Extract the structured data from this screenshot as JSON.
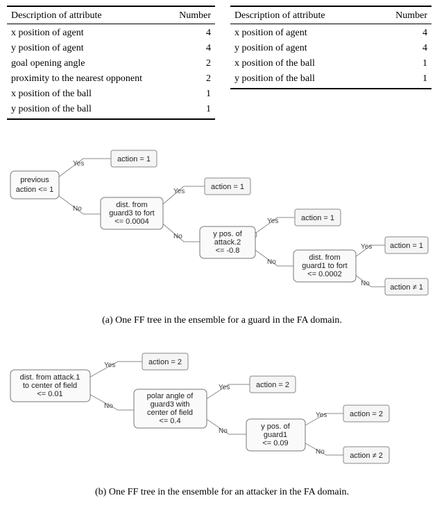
{
  "tables": {
    "left": {
      "headers": {
        "desc": "Description of attribute",
        "num": "Number"
      },
      "rows": [
        {
          "desc": "x position of agent",
          "num": "4"
        },
        {
          "desc": "y position of agent",
          "num": "4"
        },
        {
          "desc": "goal opening angle",
          "num": "2"
        },
        {
          "desc": "proximity to the nearest opponent",
          "num": "2"
        },
        {
          "desc": "x position of the ball",
          "num": "1"
        },
        {
          "desc": "y position of the ball",
          "num": "1"
        }
      ]
    },
    "right": {
      "headers": {
        "desc": "Description of attribute",
        "num": "Number"
      },
      "rows": [
        {
          "desc": "x position of agent",
          "num": "4"
        },
        {
          "desc": "y position of agent",
          "num": "4"
        },
        {
          "desc": "x position of the ball",
          "num": "1"
        },
        {
          "desc": "y position of the ball",
          "num": "1"
        }
      ]
    }
  },
  "labels": {
    "yes": "Yes",
    "no": "No"
  },
  "treeA": {
    "caption": "(a) One FF tree in the ensemble for a guard in the FA domain.",
    "n0": {
      "l1": "previous",
      "l2": "action <= 1"
    },
    "leaf0y": "action = 1",
    "n1": {
      "l1": "dist. from",
      "l2": "guard3 to fort",
      "l3": "<= 0.0004"
    },
    "leaf1y": "action = 1",
    "n2": {
      "l1": "y pos. of",
      "l2": "attack.2",
      "l3": "<= -0.8"
    },
    "leaf2y": "action = 1",
    "n3": {
      "l1": "dist. from",
      "l2": "guard1 to fort",
      "l3": "<= 0.0002"
    },
    "leaf3y": "action = 1",
    "leaf3n": "action ≠ 1"
  },
  "treeB": {
    "caption": "(b) One FF tree in the ensemble for an attacker in the FA domain.",
    "n0": {
      "l1": "dist. from attack.1",
      "l2": "to center of field",
      "l3": "<= 0.01"
    },
    "leaf0y": "action = 2",
    "n1": {
      "l1": "polar angle of",
      "l2": "guard3 with",
      "l3": "center of field",
      "l4": "<= 0.4"
    },
    "leaf1y": "action = 2",
    "n2": {
      "l1": "y pos. of",
      "l2": "guard1",
      "l3": "<= 0.09"
    },
    "leaf2y": "action = 2",
    "leaf2n": "action ≠ 2"
  }
}
